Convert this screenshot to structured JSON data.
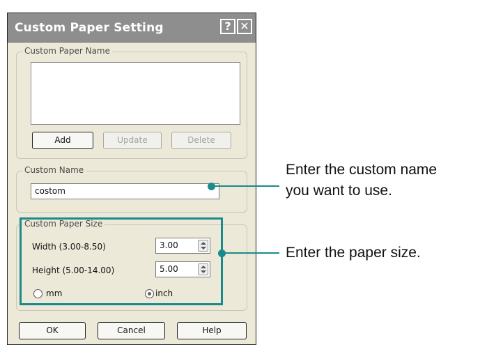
{
  "dialog": {
    "title": "Custom Paper Setting",
    "help_icon": "question-mark-icon",
    "close_icon": "close-x-icon"
  },
  "custom_paper_name": {
    "legend": "Custom Paper Name",
    "add_label": "Add",
    "update_label": "Update",
    "delete_label": "Delete"
  },
  "custom_name": {
    "legend": "Custom Name",
    "value": "costom"
  },
  "custom_paper_size": {
    "legend": "Custom Paper Size",
    "width_label": "Width (3.00-8.50)",
    "width_value": "3.00",
    "height_label": "Height (5.00-14.00)",
    "height_value": "5.00",
    "unit_mm": "mm",
    "unit_inch": "inch",
    "selected_unit": "inch"
  },
  "footer": {
    "ok_label": "OK",
    "cancel_label": "Cancel",
    "help_label": "Help"
  },
  "callouts": {
    "name_line1": "Enter the custom name",
    "name_line2": "you want to use.",
    "size": "Enter the paper size."
  },
  "colors": {
    "callout_accent": "#1a8a8a",
    "titlebar": "#8e8e8e",
    "dialog_bg": "#ece9d8"
  }
}
